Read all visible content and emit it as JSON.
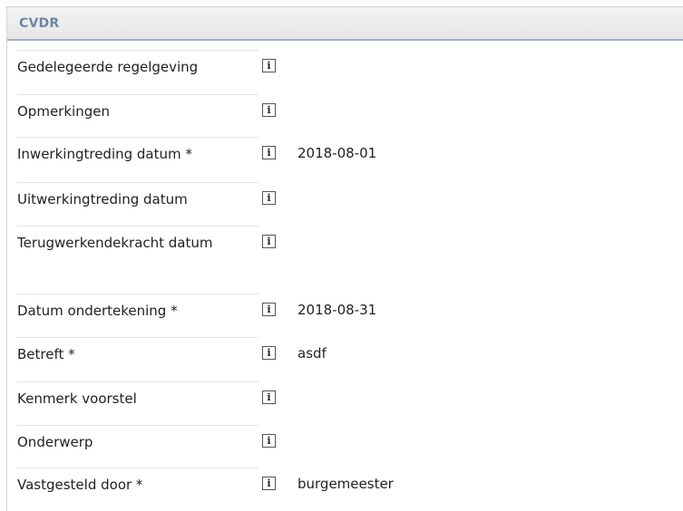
{
  "panel": {
    "title": "CVDR"
  },
  "info_icon_glyph": "i",
  "fields": [
    {
      "label": "Gedelegeerde regelgeving",
      "value": ""
    },
    {
      "label": "Opmerkingen",
      "value": ""
    },
    {
      "label": "Inwerkingtreding datum *",
      "value": "2018-08-01"
    },
    {
      "label": "Uitwerkingtreding datum",
      "value": ""
    },
    {
      "label": "Terugwerkendekracht datum",
      "value": ""
    },
    {
      "label": "Datum ondertekening *",
      "value": "2018-08-31"
    },
    {
      "label": "Betreft *",
      "value": "asdf"
    },
    {
      "label": "Kenmerk voorstel",
      "value": ""
    },
    {
      "label": "Onderwerp",
      "value": ""
    },
    {
      "label": "Vastgesteld door *",
      "value": "burgemeester"
    }
  ]
}
